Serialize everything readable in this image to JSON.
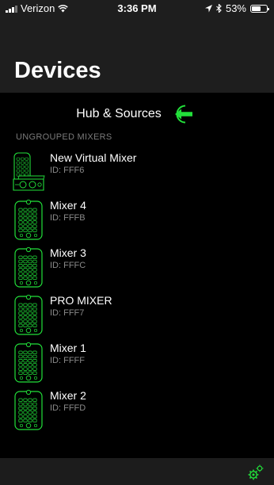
{
  "status": {
    "carrier": "Verizon",
    "time": "3:36 PM",
    "battery": "53%",
    "battery_level": 0.53
  },
  "header": {
    "title": "Devices"
  },
  "hub": {
    "label": "Hub & Sources"
  },
  "section": {
    "title": "UNGROUPED MIXERS"
  },
  "mixers": [
    {
      "name": "New Virtual Mixer",
      "id": "ID: FFF6",
      "icon": "virtual-mixer-icon"
    },
    {
      "name": "Mixer 4",
      "id": "ID: FFFB",
      "icon": "mixer-icon"
    },
    {
      "name": "Mixer 3",
      "id": "ID: FFFC",
      "icon": "mixer-icon"
    },
    {
      "name": "PRO MIXER",
      "id": "ID: FFF7",
      "icon": "mixer-icon"
    },
    {
      "name": "Mixer 1",
      "id": "ID: FFFF",
      "icon": "mixer-icon"
    },
    {
      "name": "Mixer 2",
      "id": "ID: FFFD",
      "icon": "mixer-icon"
    }
  ],
  "colors": {
    "accent": "#22e03a",
    "header_bg": "#1e1e1e",
    "footer_bg": "#1c1c1c"
  },
  "footer": {
    "icon": "settings-gears-icon"
  }
}
